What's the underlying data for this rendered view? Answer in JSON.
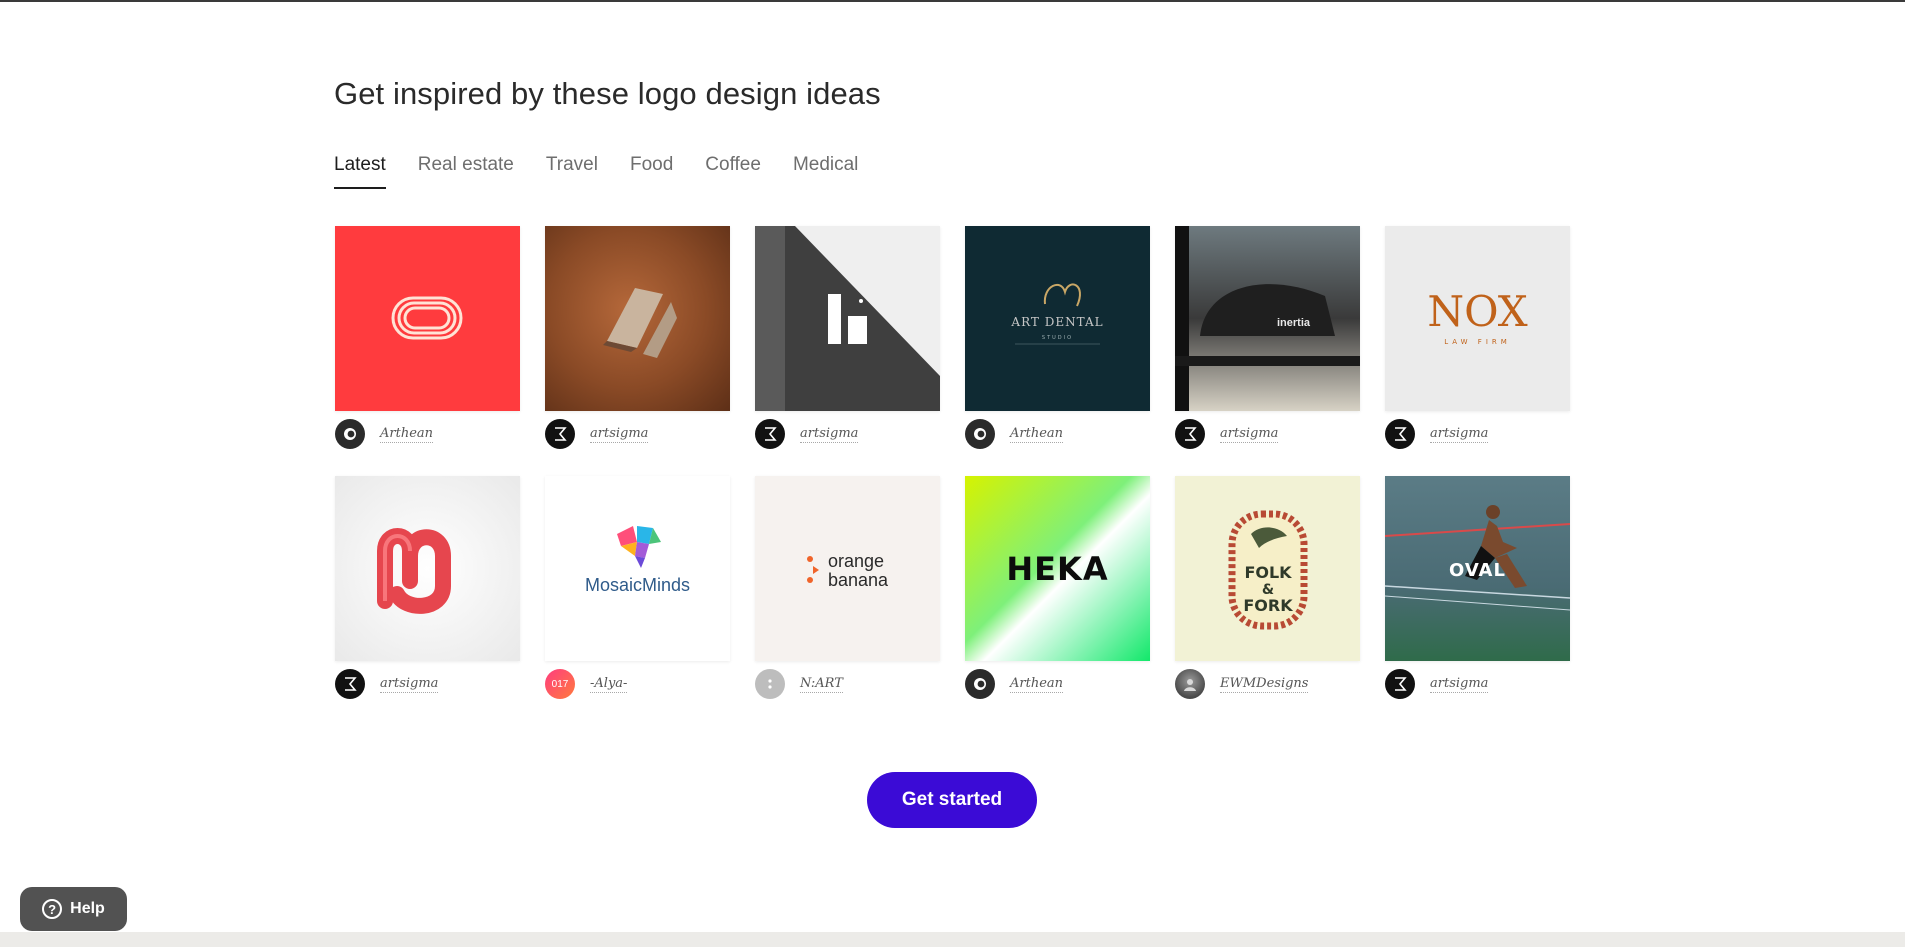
{
  "section": {
    "title": "Get inspired by these logo design ideas"
  },
  "tabs": [
    {
      "label": "Latest",
      "active": true
    },
    {
      "label": "Real estate",
      "active": false
    },
    {
      "label": "Travel",
      "active": false
    },
    {
      "label": "Food",
      "active": false
    },
    {
      "label": "Coffee",
      "active": false
    },
    {
      "label": "Medical",
      "active": false
    }
  ],
  "designs": [
    {
      "author": "Arthean",
      "avatar": "arthean-eye-icon",
      "thumb_bg": "#ff3b3e"
    },
    {
      "author": "artsigma",
      "avatar": "sigma-icon",
      "thumb_bg": "#8a4a26"
    },
    {
      "author": "artsigma",
      "avatar": "sigma-icon",
      "thumb_bg": "#efefef"
    },
    {
      "author": "Arthean",
      "avatar": "arthean-eye-icon",
      "thumb_bg": "#0f2a33",
      "logo_lines": [
        "ART DENTAL",
        "STUDIO"
      ]
    },
    {
      "author": "artsigma",
      "avatar": "sigma-icon",
      "thumb_bg": "#3a3a3a",
      "logo_lines": [
        "inertia"
      ]
    },
    {
      "author": "artsigma",
      "avatar": "sigma-icon",
      "thumb_bg": "#ebebeb",
      "logo_lines": [
        "NOX",
        "LAW FIRM"
      ]
    },
    {
      "author": "artsigma",
      "avatar": "sigma-icon",
      "thumb_bg": "#f3f3f3"
    },
    {
      "author": "-Alya-",
      "avatar": "alya-avatar",
      "avatar_text": "017",
      "thumb_bg": "#ffffff",
      "logo_lines": [
        "MosaicMinds"
      ]
    },
    {
      "author": "N:ART",
      "avatar": "default-avatar",
      "thumb_bg": "#f6f2ef",
      "logo_lines": [
        "orange",
        "banana"
      ]
    },
    {
      "author": "Arthean",
      "avatar": "arthean-eye-icon",
      "thumb_bg": "#3ee67a",
      "logo_lines": [
        "HEKA"
      ]
    },
    {
      "author": "EWMDesigns",
      "avatar": "photo-avatar",
      "thumb_bg": "#f2f2d5",
      "logo_lines": [
        "FOLK",
        "&",
        "FORK"
      ]
    },
    {
      "author": "artsigma",
      "avatar": "sigma-icon",
      "thumb_bg": "#4a6b74",
      "logo_lines": [
        "OVAL"
      ]
    }
  ],
  "cta": {
    "label": "Get started"
  },
  "help": {
    "label": "Help",
    "icon": "question-icon"
  },
  "colors": {
    "cta": "#3b0bd6",
    "help": "#525252"
  }
}
